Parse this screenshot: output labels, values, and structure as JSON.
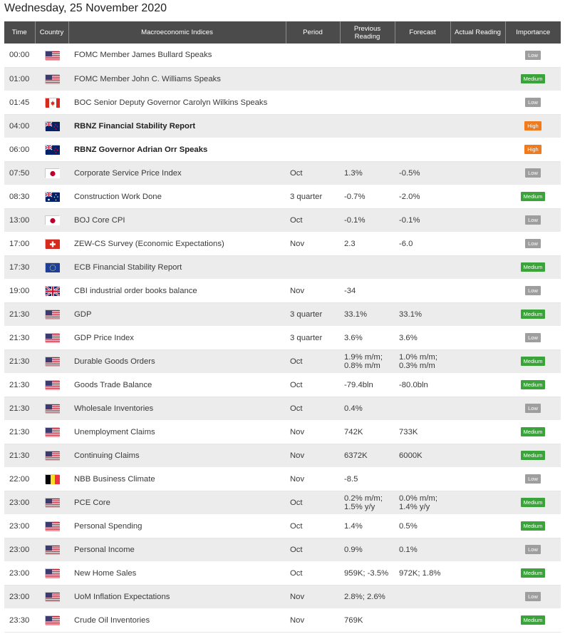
{
  "page_title": "Wednesday, 25 November 2020",
  "columns": {
    "time": "Time",
    "country": "Country",
    "indices": "Macroeconomic Indices",
    "period": "Period",
    "previous": "Previous Reading",
    "previous_line1": "Previous",
    "previous_line2": "Reading",
    "forecast": "Forecast",
    "actual": "Actual Reading",
    "importance": "Importance"
  },
  "colors": {
    "header_bg": "#4b4b4b",
    "low": "#9e9e9e",
    "medium": "#3aa33a",
    "high": "#f07a1c"
  },
  "events": [
    {
      "time": "00:00",
      "country": "us",
      "name": "FOMC Member James Bullard Speaks",
      "bold": false,
      "period": "",
      "previous": [
        ""
      ],
      "forecast": [
        ""
      ],
      "actual": "",
      "importance": "Low",
      "level": "low"
    },
    {
      "time": "01:00",
      "country": "us",
      "name": "FOMC Member John C. Williams Speaks",
      "bold": false,
      "period": "",
      "previous": [
        ""
      ],
      "forecast": [
        ""
      ],
      "actual": "",
      "importance": "Medium",
      "level": "medium"
    },
    {
      "time": "01:45",
      "country": "ca",
      "name": "BOC Senior Deputy Governor Carolyn Wilkins Speaks",
      "bold": false,
      "period": "",
      "previous": [
        ""
      ],
      "forecast": [
        ""
      ],
      "actual": "",
      "importance": "Low",
      "level": "low"
    },
    {
      "time": "04:00",
      "country": "nz",
      "name": "RBNZ Financial Stability Report",
      "bold": true,
      "period": "",
      "previous": [
        ""
      ],
      "forecast": [
        ""
      ],
      "actual": "",
      "importance": "High",
      "level": "high"
    },
    {
      "time": "06:00",
      "country": "nz",
      "name": "RBNZ Governor Adrian Orr Speaks",
      "bold": true,
      "period": "",
      "previous": [
        ""
      ],
      "forecast": [
        ""
      ],
      "actual": "",
      "importance": "High",
      "level": "high"
    },
    {
      "time": "07:50",
      "country": "jp",
      "name": "Corporate Service Price Index",
      "bold": false,
      "period": "Oct",
      "previous": [
        "1.3%"
      ],
      "forecast": [
        "-0.5%"
      ],
      "actual": "",
      "importance": "Low",
      "level": "low"
    },
    {
      "time": "08:30",
      "country": "au",
      "name": "Construction Work Done",
      "bold": false,
      "period": "3 quarter",
      "previous": [
        "-0.7%"
      ],
      "forecast": [
        "-2.0%"
      ],
      "actual": "",
      "importance": "Medium",
      "level": "medium"
    },
    {
      "time": "13:00",
      "country": "jp",
      "name": "BOJ Core CPI",
      "bold": false,
      "period": "Oct",
      "previous": [
        "-0.1%"
      ],
      "forecast": [
        "-0.1%"
      ],
      "actual": "",
      "importance": "Low",
      "level": "low"
    },
    {
      "time": "17:00",
      "country": "ch",
      "name": "ZEW-CS Survey (Economic Expectations)",
      "bold": false,
      "period": "Nov",
      "previous": [
        "2.3"
      ],
      "forecast": [
        "-6.0"
      ],
      "actual": "",
      "importance": "Low",
      "level": "low"
    },
    {
      "time": "17:30",
      "country": "eu",
      "name": "ECB Financial Stability Report",
      "bold": false,
      "period": "",
      "previous": [
        ""
      ],
      "forecast": [
        ""
      ],
      "actual": "",
      "importance": "Medium",
      "level": "medium"
    },
    {
      "time": "19:00",
      "country": "gb",
      "name": "CBI industrial order books balance",
      "bold": false,
      "period": "Nov",
      "previous": [
        "-34"
      ],
      "forecast": [
        ""
      ],
      "actual": "",
      "importance": "Low",
      "level": "low"
    },
    {
      "time": "21:30",
      "country": "us",
      "name": "GDP",
      "bold": false,
      "period": "3 quarter",
      "previous": [
        "33.1%"
      ],
      "forecast": [
        "33.1%"
      ],
      "actual": "",
      "importance": "Medium",
      "level": "medium"
    },
    {
      "time": "21:30",
      "country": "us",
      "name": "GDP Price Index",
      "bold": false,
      "period": "3 quarter",
      "previous": [
        "3.6%"
      ],
      "forecast": [
        "3.6%"
      ],
      "actual": "",
      "importance": "Low",
      "level": "low"
    },
    {
      "time": "21:30",
      "country": "us",
      "name": "Durable Goods Orders",
      "bold": false,
      "period": "Oct",
      "previous": [
        "1.9% m/m;",
        "0.8% m/m"
      ],
      "forecast": [
        "1.0% m/m;",
        "0.3% m/m"
      ],
      "actual": "",
      "importance": "Medium",
      "level": "medium"
    },
    {
      "time": "21:30",
      "country": "us",
      "name": "Goods Trade Balance",
      "bold": false,
      "period": "Oct",
      "previous": [
        "-79.4bln"
      ],
      "forecast": [
        "-80.0bln"
      ],
      "actual": "",
      "importance": "Medium",
      "level": "medium"
    },
    {
      "time": "21:30",
      "country": "us",
      "name": "Wholesale Inventories",
      "bold": false,
      "period": "Oct",
      "previous": [
        "0.4%"
      ],
      "forecast": [
        ""
      ],
      "actual": "",
      "importance": "Low",
      "level": "low"
    },
    {
      "time": "21:30",
      "country": "us",
      "name": "Unemployment Claims",
      "bold": false,
      "period": "Nov",
      "previous": [
        "742K"
      ],
      "forecast": [
        "733K"
      ],
      "actual": "",
      "importance": "Medium",
      "level": "medium"
    },
    {
      "time": "21:30",
      "country": "us",
      "name": "Continuing Claims",
      "bold": false,
      "period": "Nov",
      "previous": [
        "6372K"
      ],
      "forecast": [
        "6000K"
      ],
      "actual": "",
      "importance": "Medium",
      "level": "medium"
    },
    {
      "time": "22:00",
      "country": "be",
      "name": "NBB Business Climate",
      "bold": false,
      "period": "Nov",
      "previous": [
        "-8.5"
      ],
      "forecast": [
        ""
      ],
      "actual": "",
      "importance": "Low",
      "level": "low"
    },
    {
      "time": "23:00",
      "country": "us",
      "name": "PCE Core",
      "bold": false,
      "period": "Oct",
      "previous": [
        "0.2% m/m;",
        "1.5% y/y"
      ],
      "forecast": [
        "0.0% m/m;",
        "1.4% y/y"
      ],
      "actual": "",
      "importance": "Medium",
      "level": "medium"
    },
    {
      "time": "23:00",
      "country": "us",
      "name": "Personal Spending",
      "bold": false,
      "period": "Oct",
      "previous": [
        "1.4%"
      ],
      "forecast": [
        "0.5%"
      ],
      "actual": "",
      "importance": "Medium",
      "level": "medium"
    },
    {
      "time": "23:00",
      "country": "us",
      "name": "Personal Income",
      "bold": false,
      "period": "Oct",
      "previous": [
        "0.9%"
      ],
      "forecast": [
        "0.1%"
      ],
      "actual": "",
      "importance": "Low",
      "level": "low"
    },
    {
      "time": "23:00",
      "country": "us",
      "name": "New Home Sales",
      "bold": false,
      "period": "Oct",
      "previous": [
        "959K; -3.5%"
      ],
      "forecast": [
        "972K; 1.8%"
      ],
      "actual": "",
      "importance": "Medium",
      "level": "medium"
    },
    {
      "time": "23:00",
      "country": "us",
      "name": "UoM Inflation Expectations",
      "bold": false,
      "period": "Nov",
      "previous": [
        "2.8%; 2.6%"
      ],
      "forecast": [
        ""
      ],
      "actual": "",
      "importance": "Low",
      "level": "low"
    },
    {
      "time": "23:30",
      "country": "us",
      "name": "Crude Oil Inventories",
      "bold": false,
      "period": "Nov",
      "previous": [
        "769K"
      ],
      "forecast": [
        ""
      ],
      "actual": "",
      "importance": "Medium",
      "level": "medium"
    }
  ]
}
